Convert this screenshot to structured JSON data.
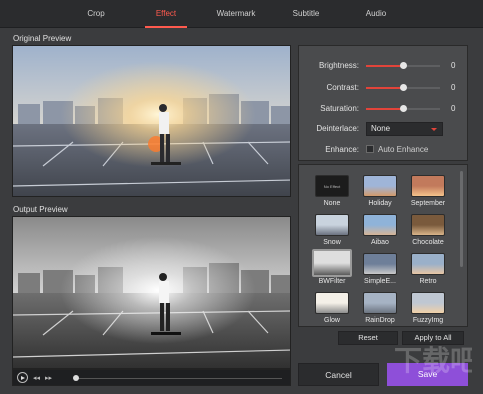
{
  "tabs": [
    {
      "label": "Crop"
    },
    {
      "label": "Effect"
    },
    {
      "label": "Watermark"
    },
    {
      "label": "Subtitle"
    },
    {
      "label": "Audio"
    }
  ],
  "active_tab": "Effect",
  "original_preview_label": "Original Preview",
  "output_preview_label": "Output Preview",
  "adjust": {
    "brightness": {
      "label": "Brightness:",
      "value": "0",
      "level": 0.5
    },
    "contrast": {
      "label": "Contrast:",
      "value": "0",
      "level": 0.5
    },
    "saturation": {
      "label": "Saturation:",
      "value": "0",
      "level": 0.5
    },
    "deinterlace": {
      "label": "Deinterlace:",
      "selected": "None"
    },
    "enhance": {
      "label": "Enhance:",
      "checkbox_label": "Auto Enhance",
      "checked": false
    }
  },
  "filters": [
    {
      "name": "None"
    },
    {
      "name": "Holiday"
    },
    {
      "name": "September"
    },
    {
      "name": "Snow"
    },
    {
      "name": "Aibao"
    },
    {
      "name": "Chocolate"
    },
    {
      "name": "BWFilter"
    },
    {
      "name": "SimpleE..."
    },
    {
      "name": "Retro"
    },
    {
      "name": "Glow"
    },
    {
      "name": "RainDrop"
    },
    {
      "name": "FuzzyImg"
    }
  ],
  "selected_filter": "BWFilter",
  "none_thumb_text": "No Effect",
  "buttons": {
    "reset": "Reset",
    "apply_to_all": "Apply to All",
    "cancel": "Cancel",
    "save": "Save"
  },
  "colors": {
    "accent": "#ff5a4e",
    "save": "#8e4fd9",
    "background": "#3b3c3e"
  },
  "watermark_text": "下载吧"
}
